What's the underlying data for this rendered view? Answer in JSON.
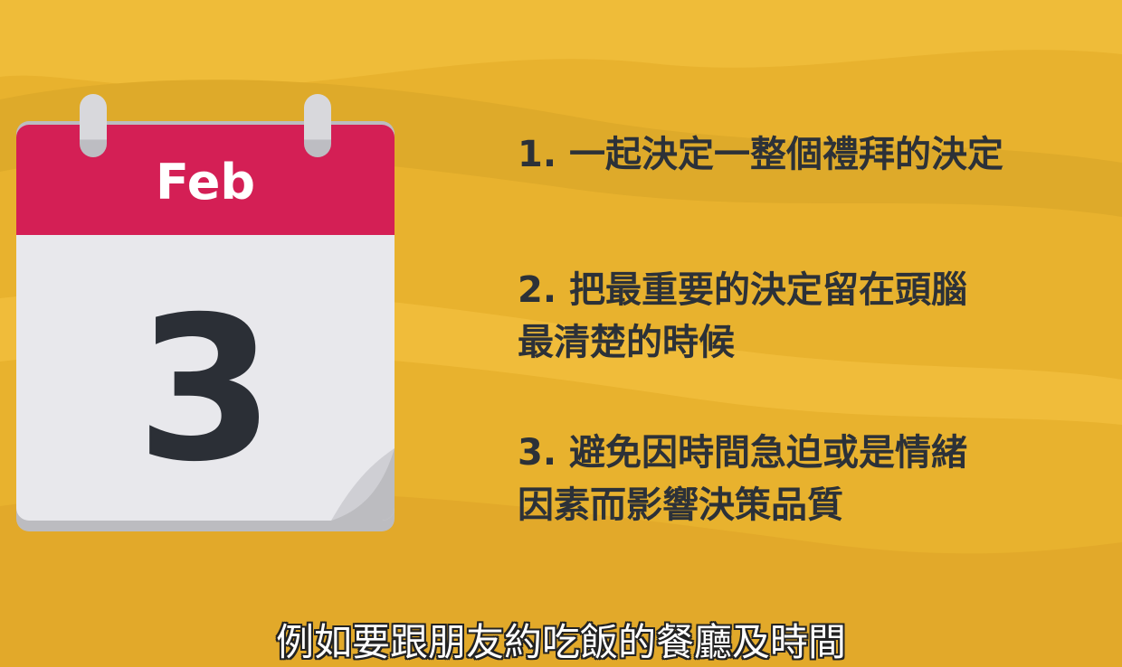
{
  "background": {
    "colors": [
      "#e9b32c",
      "#dfa628",
      "#f0bd3a"
    ]
  },
  "calendar": {
    "month": "Feb",
    "day": "3",
    "colors": {
      "header": "#d41f55",
      "page": "#e8e8ec",
      "text": "#2b2f36"
    }
  },
  "points": [
    {
      "text": "1. 一起決定一整個禮拜的決定"
    },
    {
      "text": "2. 把最重要的決定留在頭腦\n最清楚的時候"
    },
    {
      "text": "3. 避免因時間急迫或是情緒\n因素而影響決策品質"
    }
  ],
  "subtitle": {
    "text": "例如要跟朋友約吃飯的餐廳及時間"
  }
}
